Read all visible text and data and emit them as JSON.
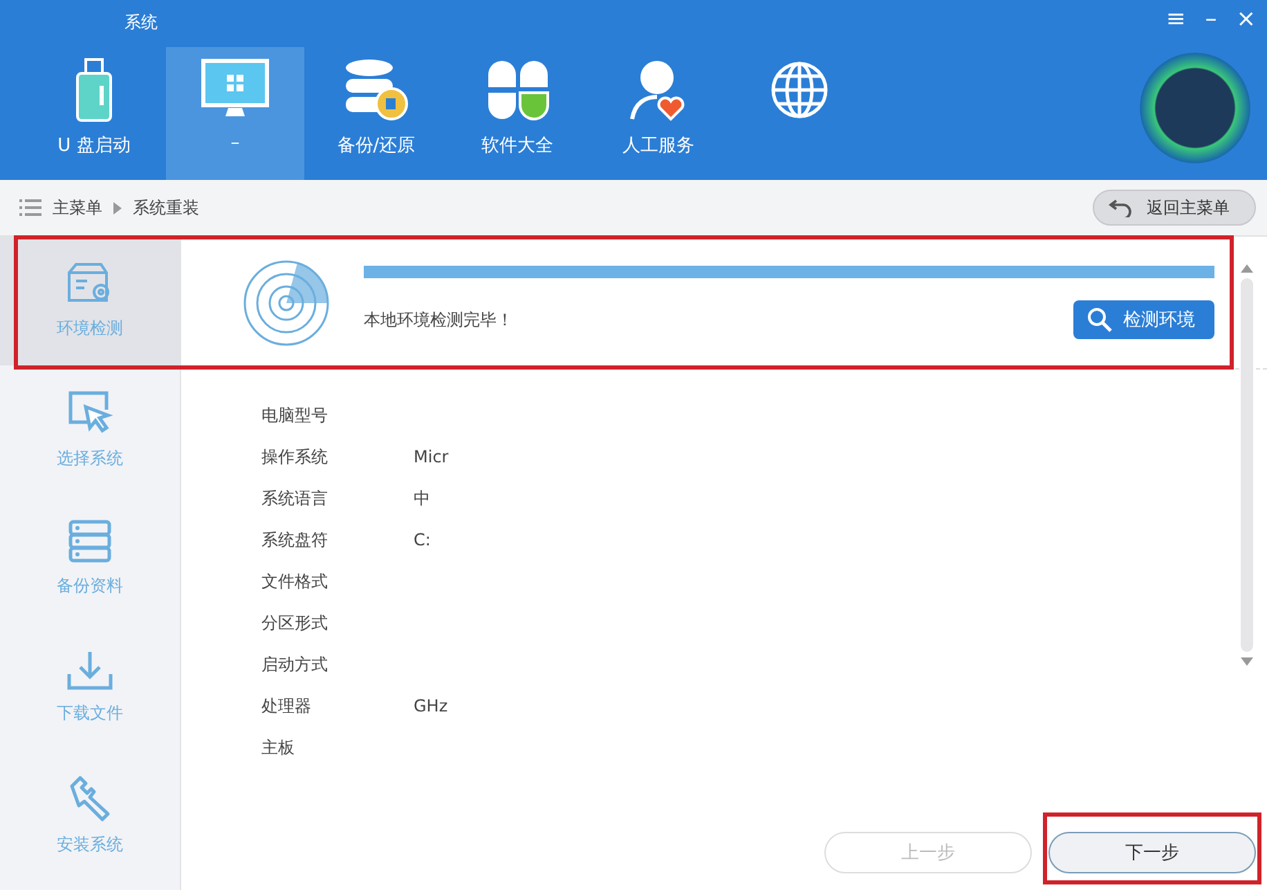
{
  "window": {
    "title": "系统",
    "controls": [
      "≡",
      "–",
      "×"
    ]
  },
  "nav": [
    {
      "kind": "usb",
      "label": "U 盘启动",
      "selected": false
    },
    {
      "kind": "monitor",
      "label": "–",
      "selected": true
    },
    {
      "kind": "database",
      "label": "备份/还原",
      "selected": false
    },
    {
      "kind": "apps",
      "label": "软件大全",
      "selected": false
    },
    {
      "kind": "person",
      "label": "人工服务",
      "selected": false
    },
    {
      "kind": "globe",
      "selected": false
    }
  ],
  "breadcrumb": {
    "items": [
      "主菜单",
      "系统重装"
    ],
    "back_button": "返回主菜单"
  },
  "sidebar": {
    "items": [
      {
        "kind": "env",
        "label": "环境检测",
        "selected": true
      },
      {
        "kind": "cursor",
        "label": "选择系统",
        "selected": false
      },
      {
        "kind": "stack",
        "label": "备份资料",
        "selected": false
      },
      {
        "kind": "download",
        "label": "下载文件",
        "selected": false
      },
      {
        "kind": "wrench",
        "label": "安装系统",
        "selected": false
      }
    ]
  },
  "detection": {
    "level": 1,
    "message": "本地环境检测完毕！",
    "button": "检测环境"
  },
  "info": [
    {
      "label": "电脑型号"
    },
    {
      "label": "操作系统",
      "value": "Micr"
    },
    {
      "label": "系统语言",
      "value": "中"
    },
    {
      "label": "系统盘符",
      "value": "C:"
    },
    {
      "label": "文件格式"
    },
    {
      "label": "分区形式"
    },
    {
      "label": "启动方式"
    },
    {
      "label": "处理器",
      "value": "GHz"
    },
    {
      "label": "主板"
    }
  ],
  "footer": {
    "prev": {
      "label": "上一步",
      "disabled": true
    },
    "next": {
      "label": "下一步",
      "disabled": false
    }
  }
}
